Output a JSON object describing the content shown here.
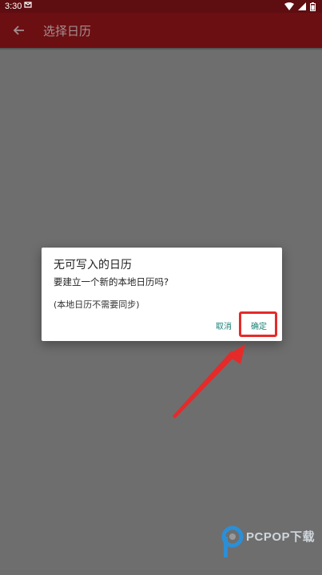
{
  "status_bar": {
    "time": "3:30",
    "mail_icon": "mail-icon"
  },
  "app_bar": {
    "back_icon": "arrow-back-icon",
    "title": "选择日历"
  },
  "dialog": {
    "title": "无可写入的日历",
    "message": "要建立一个新的本地日历吗?",
    "note": "(本地日历不需要同步)",
    "cancel_label": "取消",
    "confirm_label": "确定"
  },
  "watermark": {
    "text": "PCPOP下载"
  },
  "colors": {
    "status_bar_bg": "#5e0d10",
    "app_bar_bg": "#6b0f13",
    "scrim": "#6e6e6e",
    "dialog_button": "#1b8078",
    "highlight_red": "#e52a2a"
  }
}
